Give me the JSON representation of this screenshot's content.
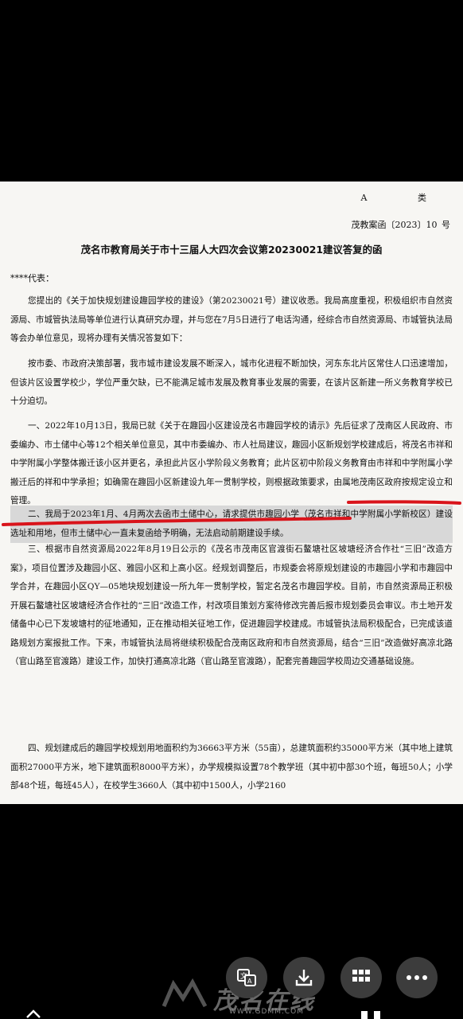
{
  "document": {
    "category": "A 类",
    "doc_number": "茂教案函〔2023〕10 号",
    "title": "茂名市教育局关于市十三届人大四次会议第20230021建议答复的函",
    "salutation": "****代表：",
    "paragraphs": [
      "您提出的《关于加快规划建设趣园学校的建设》（第20230021号）建议收悉。我局高度重视，积极组织市自然资源局、市城管执法局等单位进行认真研究办理，并与您在7月5日进行了电话沟通，经综合市自然资源局、市城管执法局等会办单位意见，现将办理有关情况答复如下：",
      "按市委、市政府决策部署，我市城市建设发展不断深入，城市化进程不断加快，河东东北片区常住人口迅速增加，但该片区设置学校少，学位严重欠缺，已不能满足城市发展及教育事业发展的需要，在该片区新建一所义务教育学校已十分迫切。",
      "一、2022年10月13日，我局已就《关于在趣园小区建设茂名市趣园学校的请示》先后征求了茂南区人民政府、市委编办、市土储中心等12个相关单位意见，其中市委编办、市人社局建议，趣园小区新规划学校建成后，将茂名市祥和中学附属小学整体搬迁该小区并更名，承担此片区小学阶段义务教育；此片区初中阶段义务教育由市祥和中学附属小学搬迁后的祥和中学承担；如确需在趣园小区新建设九年一贯制学校，则根据政策要求，由属地茂南区政府按规定设立和管理。",
      "二、我局于2023年1月、4月两次去函市土储中心，请求提供市趣园小学（茂名市祥和中学附属小学新校区）建设选址和用地，但市土储中心一直未复函给予明确，无法启动前期建设手续。",
      "三、根据市自然资源局2022年8月19日公示的《茂名市茂南区官渡街石鳌塘社区坡塘经济合作社“三旧”改造方案》，项目位置涉及趣园小区、雅园小区和上高小区。经规划调整后，市规委会将原规划建设的市趣园小学和市趣园中学合并，在趣园小区QY—05地块规划建设一所九年一贯制学校，暂定名茂名市趣园学校。目前，市自然资源局正积极开展石鳌塘社区坡塘经济合作社的“三旧”改造工作，村改项目策划方案待修改完善后报市规划委员会审议。市土地开发储备中心已下发坡塘村的征地通知，正在推动相关征地工作，促进趣园学校建成。市城管执法局积极配合，已完成该道路规划方案报批工作。下来，市城管执法局将继续积极配合茂南区政府和市自然资源局，结合“三旧”改造做好高凉北路（官山路至官渡路）建设工作，加快打通高凉北路（官山路至官渡路），配套完善趣园学校周边交通基础设施。",
      "四、规划建成后的趣园学校规划用地面积约为36663平方米（55亩），总建筑面积约35000平方米（其中地上建筑面积27000平方米，地下建筑面积8000平方米），办学规模拟设置78个教学班（其中初中部30个班，每班50人；小学部48个班，每班45人），在校学生3660人（其中初中1500人，小学2160"
    ]
  },
  "watermark": {
    "brand": "茂名在线",
    "url": "WWW.GDMM.COM"
  },
  "toolbar": {
    "buttons": [
      {
        "name": "translate",
        "icon": "translate-icon"
      },
      {
        "name": "download",
        "icon": "download-icon"
      },
      {
        "name": "grid",
        "icon": "grid-icon"
      },
      {
        "name": "more",
        "icon": "more-icon"
      }
    ]
  },
  "colors": {
    "marker_red": "#d9141b",
    "highlight_gray": "#d8d8d8",
    "paper": "#f7f6f3"
  }
}
